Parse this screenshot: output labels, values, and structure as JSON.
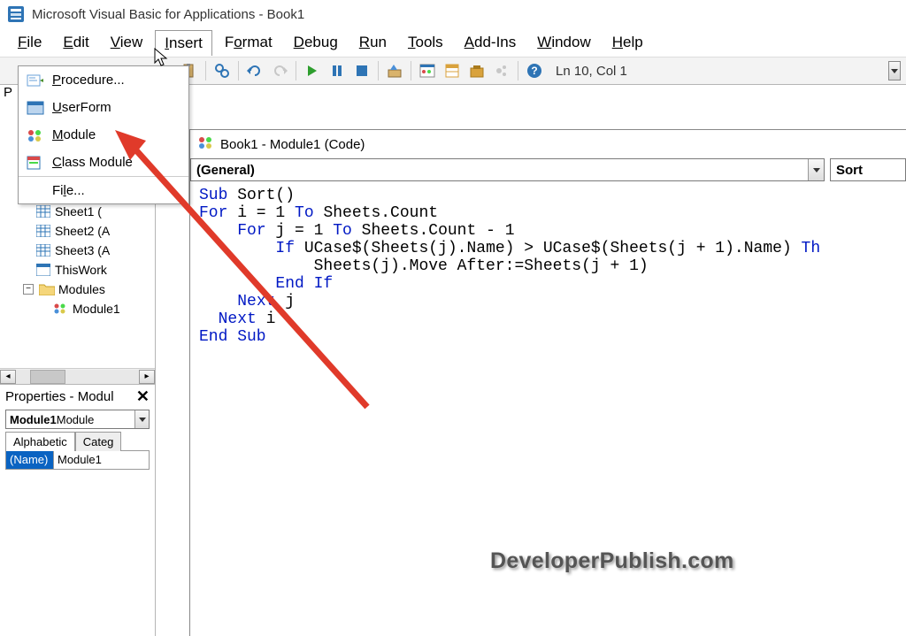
{
  "titlebar": {
    "text": "Microsoft Visual Basic for Applications - Book1"
  },
  "menubar": {
    "file": "File",
    "edit": "Edit",
    "view": "View",
    "insert": "Insert",
    "format": "Format",
    "debug": "Debug",
    "run": "Run",
    "tools": "Tools",
    "addins": "Add-Ins",
    "window": "Window",
    "help": "Help"
  },
  "dropdown": {
    "procedure": "Procedure...",
    "userform": "UserForm",
    "module": "Module",
    "class_module": "Class Module",
    "file": "File..."
  },
  "toolbar": {
    "status": "Ln 10, Col 1"
  },
  "tree": {
    "sheet1": "Sheet1 (",
    "sheet2": "Sheet2 (A",
    "sheet3": "Sheet3 (A",
    "thiswork": "ThisWork",
    "modules": "Modules",
    "module1": "Module1"
  },
  "properties": {
    "title": "Properties - Modul",
    "combo_bold": "Module1",
    "combo_rest": " Module",
    "tab_alpha": "Alphabetic",
    "tab_cat": "Categ",
    "row_name": "(Name)",
    "row_val": "Module1"
  },
  "code": {
    "title": "Book1 - Module1 (Code)",
    "combo_left": "(General)",
    "combo_right": "Sort",
    "l1a": "Sub",
    "l1b": " Sort()",
    "l2a": "For",
    "l2b": " i = 1 ",
    "l2c": "To",
    "l2d": " Sheets.Count",
    "l3a": "    ",
    "l3b": "For",
    "l3c": " j = 1 ",
    "l3d": "To",
    "l3e": " Sheets.Count - 1",
    "l4a": "        ",
    "l4b": "If",
    "l4c": " UCase$(Sheets(j).Name) > UCase$(Sheets(j + 1).Name) ",
    "l4d": "Th",
    "l5": "            Sheets(j).Move After:=Sheets(j + 1)",
    "l6a": "        ",
    "l6b": "End If",
    "l7a": "    ",
    "l7b": "Next",
    "l7c": " j",
    "l8a": "  ",
    "l8b": "Next",
    "l8c": " i",
    "l9": "End Sub"
  },
  "watermark": "DeveloperPublish.com"
}
